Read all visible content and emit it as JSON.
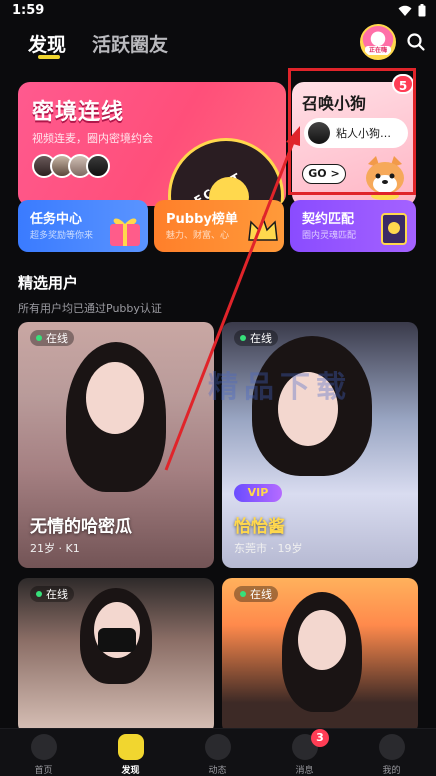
{
  "status_bar": {
    "time": "1:59"
  },
  "top_nav": {
    "tabs": [
      {
        "label": "发现",
        "active": true
      },
      {
        "label": "活跃圈友",
        "active": false
      }
    ],
    "avatar_tag": "正在嗨"
  },
  "banners": {
    "secret": {
      "title": "密境连线",
      "subtitle": "视频连麦，圈内密境约会",
      "ring_text": "SECRET REA"
    },
    "summon": {
      "title": "召唤小狗",
      "message": "粘人小狗…",
      "go_label": "GO >",
      "badge_count": "5"
    }
  },
  "feature_cards": [
    {
      "title": "任务中心",
      "subtitle": "超多奖励等你来"
    },
    {
      "title": "Pubby榜单",
      "subtitle": "魅力、财富、心"
    },
    {
      "title": "契约匹配",
      "subtitle": "圈内灵魂匹配"
    }
  ],
  "section": {
    "title": "精选用户",
    "subtitle": "所有用户均已通过Pubby认证"
  },
  "users": [
    {
      "status": "在线",
      "name": "无情的哈密瓜",
      "meta": "21岁 · K1"
    },
    {
      "status": "在线",
      "name": "怡怡酱",
      "meta": "东莞市 · 19岁",
      "vip": "VIP"
    },
    {
      "status": "在线",
      "name": "",
      "meta": ""
    },
    {
      "status": "在线",
      "name": "",
      "meta": ""
    }
  ],
  "watermark": {
    "text": "精品下载"
  },
  "bottom_nav": {
    "items": [
      {
        "label": "首页"
      },
      {
        "label": "发现"
      },
      {
        "label": "动态"
      },
      {
        "label": "消息",
        "badge": "3"
      },
      {
        "label": "我的"
      }
    ]
  },
  "colors": {
    "accent": "#f1d62f",
    "annotation_red": "#e0242a",
    "badge_red": "#ff3d55"
  }
}
